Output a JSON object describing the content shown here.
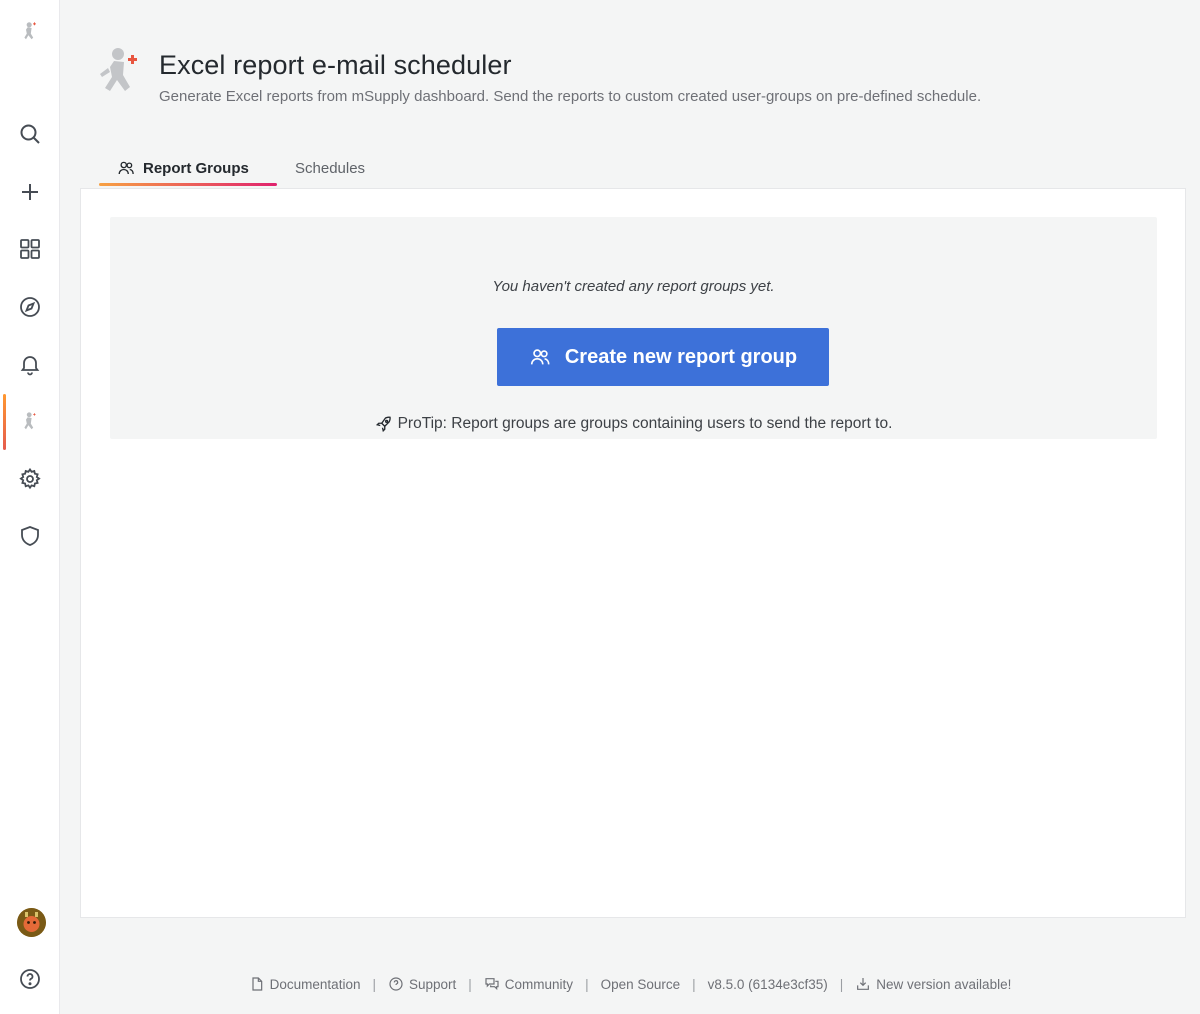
{
  "header": {
    "title": "Excel report e-mail scheduler",
    "subtitle": "Generate Excel reports from mSupply dashboard. Send the reports to custom created user-groups on pre-defined schedule."
  },
  "tabs": [
    {
      "label": "Report Groups",
      "active": true,
      "icon": "users-icon"
    },
    {
      "label": "Schedules",
      "active": false
    }
  ],
  "empty_state": {
    "message": "You haven't created any report groups yet.",
    "button_label": "Create new report group",
    "protip": "ProTip: Report groups are groups containing users to send the report to."
  },
  "sidebar": {
    "items": [
      "logo-icon",
      "search-icon",
      "plus-icon",
      "dashboards-icon",
      "explore-icon",
      "bell-icon",
      "plugin-app-icon",
      "gear-icon",
      "shield-icon"
    ],
    "bottom": [
      "avatar",
      "help-icon"
    ]
  },
  "footer": {
    "documentation": "Documentation",
    "support": "Support",
    "community": "Community",
    "open_source": "Open Source",
    "version": "v8.5.0 (6134e3cf35)",
    "new_version": "New version available!"
  },
  "colors": {
    "primary_button": "#3d71d9",
    "tab_underline_start": "#f7a143",
    "tab_underline_end": "#e0226e",
    "active_sidebar": "#e55b4d"
  }
}
